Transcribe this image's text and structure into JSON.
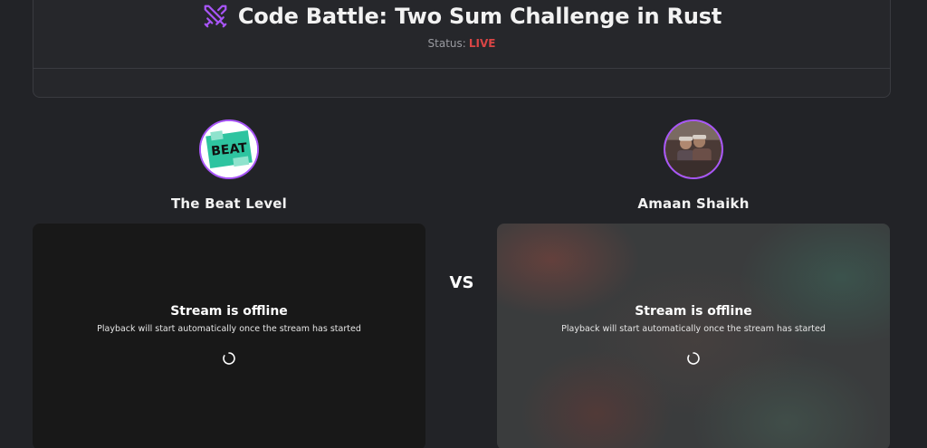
{
  "header": {
    "title": "Code Battle: Two Sum Challenge in Rust",
    "status_label": "Status:",
    "status_value": "LIVE",
    "icon": "crossed-swords-icon"
  },
  "players": [
    {
      "name": "The Beat Level",
      "avatar_logo_text": "BEAT",
      "stream": {
        "title": "Stream is offline",
        "subtitle": "Playback will start automatically once the stream has started"
      }
    },
    {
      "name": "Amaan Shaikh",
      "stream": {
        "title": "Stream is offline",
        "subtitle": "Playback will start automatically once the stream has started"
      }
    }
  ],
  "vs_label": "VS",
  "colors": {
    "accent": "#a855f7",
    "live": "#d94545",
    "background": "#222327"
  }
}
